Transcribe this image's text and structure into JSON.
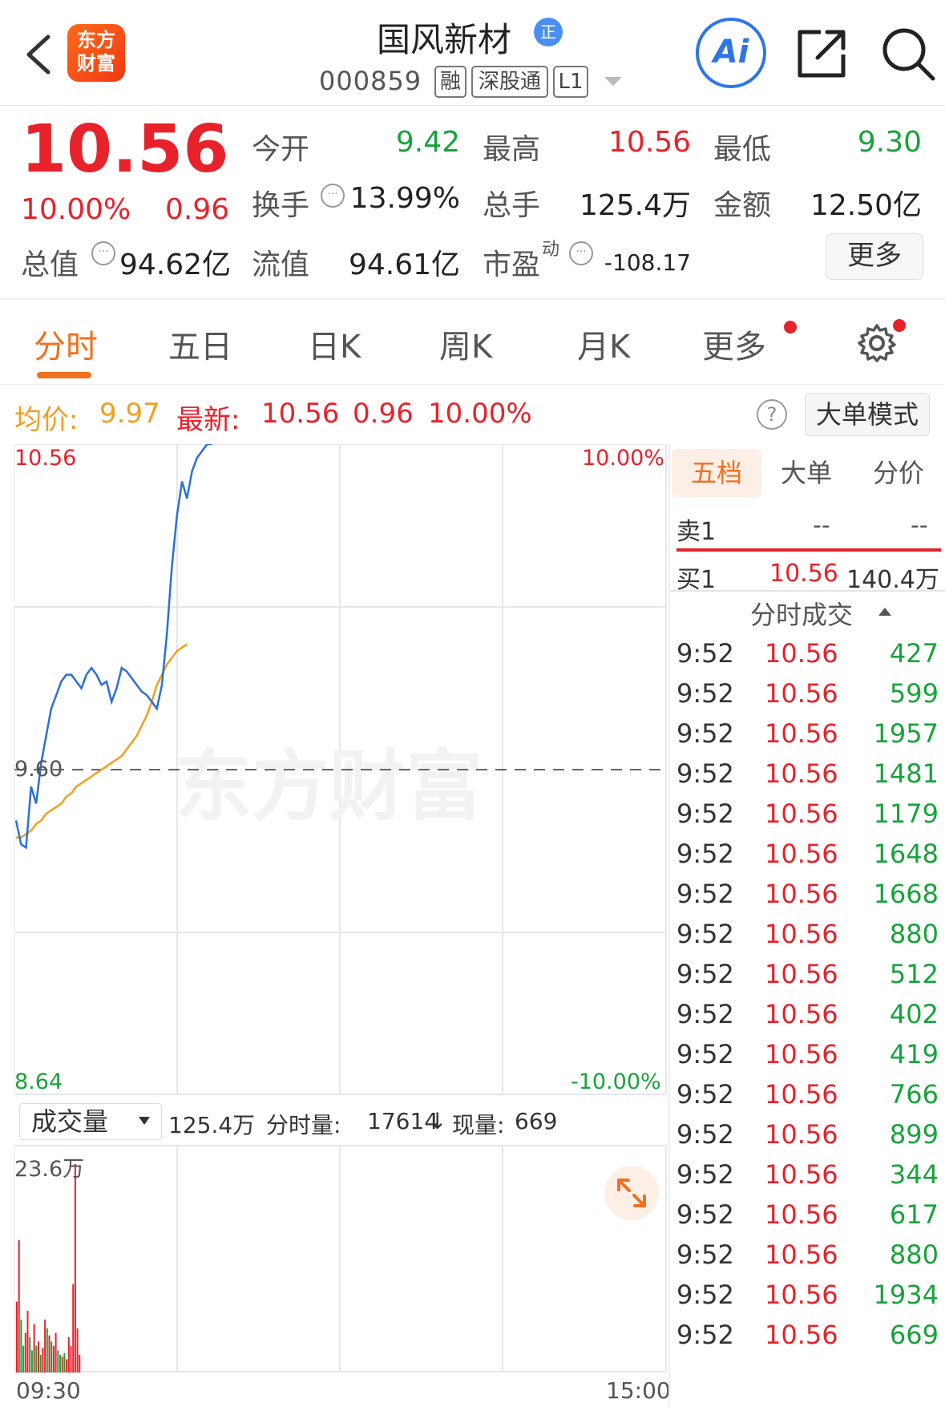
{
  "header": {
    "logo_text_1": "东方",
    "logo_text_2": "财富",
    "name": "国风新材",
    "name_badge": "正",
    "code": "000859",
    "tags": [
      "融",
      "深股通",
      "L1"
    ],
    "ai_label": "Ai"
  },
  "quote": {
    "price": "10.56",
    "change_pct": "10.00%",
    "change": "0.96",
    "open_label": "今开",
    "open": "9.42",
    "high_label": "最高",
    "high": "10.56",
    "low_label": "最低",
    "low": "9.30",
    "turnover_label": "换手",
    "turnover": "13.99%",
    "volume_label": "总手",
    "volume": "125.4万",
    "amount_label": "金额",
    "amount": "12.50亿",
    "mktcap_label": "总值",
    "mktcap": "94.62亿",
    "float_label": "流值",
    "float": "94.61亿",
    "pe_label": "市盈",
    "pe_sup": "动",
    "pe": "-108.17",
    "more_label": "更多"
  },
  "tabs": [
    "分时",
    "五日",
    "日K",
    "周K",
    "月K",
    "更多"
  ],
  "info_line": {
    "avg_label": "均价:",
    "avg": "9.97",
    "latest_label": "最新:",
    "latest": "10.56",
    "latest_chg": "0.96",
    "latest_pct": "10.00%",
    "help": "?",
    "big_order_label": "大单模式"
  },
  "chart_data": {
    "type": "line",
    "y_top": "10.56",
    "y_mid": "9.60",
    "y_bottom": "8.64",
    "pct_top": "10.00%",
    "pct_bottom": "-10.00%",
    "x_start": "09:30",
    "x_end": "15:00",
    "ylim": [
      8.64,
      10.56
    ],
    "baseline": 9.6,
    "watermark": "东方财富",
    "series": [
      {
        "color": "#2b6fd8",
        "values": [
          9.45,
          9.38,
          9.37,
          9.55,
          9.5,
          9.62,
          9.7,
          9.78,
          9.82,
          9.86,
          9.88,
          9.88,
          9.86,
          9.84,
          9.88,
          9.9,
          9.88,
          9.85,
          9.86,
          9.8,
          9.84,
          9.9,
          9.89,
          9.87,
          9.85,
          9.83,
          9.82,
          9.8,
          9.78,
          9.85,
          10.0,
          10.2,
          10.35,
          10.45,
          10.4,
          10.48,
          10.52,
          10.54,
          10.56,
          10.56
        ]
      },
      {
        "color": "#f0a020",
        "values": [
          9.4,
          9.4,
          9.41,
          9.42,
          9.44,
          9.45,
          9.47,
          9.48,
          9.49,
          9.5,
          9.52,
          9.53,
          9.55,
          9.56,
          9.57,
          9.58,
          9.59,
          9.6,
          9.61,
          9.62,
          9.63,
          9.64,
          9.66,
          9.68,
          9.7,
          9.73,
          9.76,
          9.8,
          9.85,
          9.88,
          9.91,
          9.93,
          9.95,
          9.96,
          9.97
        ]
      }
    ]
  },
  "volume": {
    "selector_label": "成交量",
    "total": "125.4万",
    "interval_label": "分时量:",
    "interval": "17614",
    "current_label": "现量:",
    "current": "669",
    "y_max_label": "23.6万",
    "y_max": 236000,
    "bars": [
      {
        "v": 80000,
        "c": "red"
      },
      {
        "v": 150000,
        "c": "red"
      },
      {
        "v": 60000,
        "c": "green"
      },
      {
        "v": 30000,
        "c": "green"
      },
      {
        "v": 45000,
        "c": "red"
      },
      {
        "v": 70000,
        "c": "red"
      },
      {
        "v": 40000,
        "c": "green"
      },
      {
        "v": 25000,
        "c": "green"
      },
      {
        "v": 55000,
        "c": "red"
      },
      {
        "v": 30000,
        "c": "green"
      },
      {
        "v": 35000,
        "c": "red"
      },
      {
        "v": 20000,
        "c": "green"
      },
      {
        "v": 28000,
        "c": "red"
      },
      {
        "v": 60000,
        "c": "red"
      },
      {
        "v": 50000,
        "c": "green"
      },
      {
        "v": 42000,
        "c": "red"
      },
      {
        "v": 35000,
        "c": "green"
      },
      {
        "v": 30000,
        "c": "red"
      },
      {
        "v": 45000,
        "c": "red"
      },
      {
        "v": 25000,
        "c": "green"
      },
      {
        "v": 20000,
        "c": "green"
      },
      {
        "v": 18000,
        "c": "red"
      },
      {
        "v": 22000,
        "c": "green"
      },
      {
        "v": 15000,
        "c": "red"
      },
      {
        "v": 40000,
        "c": "red"
      },
      {
        "v": 30000,
        "c": "red"
      },
      {
        "v": 100000,
        "c": "red"
      },
      {
        "v": 236000,
        "c": "red"
      },
      {
        "v": 50000,
        "c": "red"
      },
      {
        "v": 20000,
        "c": "red"
      }
    ]
  },
  "order_book": {
    "tabs": [
      "五档",
      "大单",
      "分价"
    ],
    "sell1_label": "卖1",
    "sell1_price": "--",
    "sell1_vol": "--",
    "buy1_label": "买1",
    "buy1_price": "10.56",
    "buy1_vol": "140.4万",
    "ticks_header": "分时成交",
    "ticks": [
      {
        "t": "9:52",
        "p": "10.56",
        "v": "427"
      },
      {
        "t": "9:52",
        "p": "10.56",
        "v": "599"
      },
      {
        "t": "9:52",
        "p": "10.56",
        "v": "1957"
      },
      {
        "t": "9:52",
        "p": "10.56",
        "v": "1481"
      },
      {
        "t": "9:52",
        "p": "10.56",
        "v": "1179"
      },
      {
        "t": "9:52",
        "p": "10.56",
        "v": "1648"
      },
      {
        "t": "9:52",
        "p": "10.56",
        "v": "1668"
      },
      {
        "t": "9:52",
        "p": "10.56",
        "v": "880"
      },
      {
        "t": "9:52",
        "p": "10.56",
        "v": "512"
      },
      {
        "t": "9:52",
        "p": "10.56",
        "v": "402"
      },
      {
        "t": "9:52",
        "p": "10.56",
        "v": "419"
      },
      {
        "t": "9:52",
        "p": "10.56",
        "v": "766"
      },
      {
        "t": "9:52",
        "p": "10.56",
        "v": "899"
      },
      {
        "t": "9:52",
        "p": "10.56",
        "v": "344"
      },
      {
        "t": "9:52",
        "p": "10.56",
        "v": "617"
      },
      {
        "t": "9:52",
        "p": "10.56",
        "v": "880"
      },
      {
        "t": "9:52",
        "p": "10.56",
        "v": "1934"
      },
      {
        "t": "9:52",
        "p": "10.56",
        "v": "669"
      }
    ]
  }
}
